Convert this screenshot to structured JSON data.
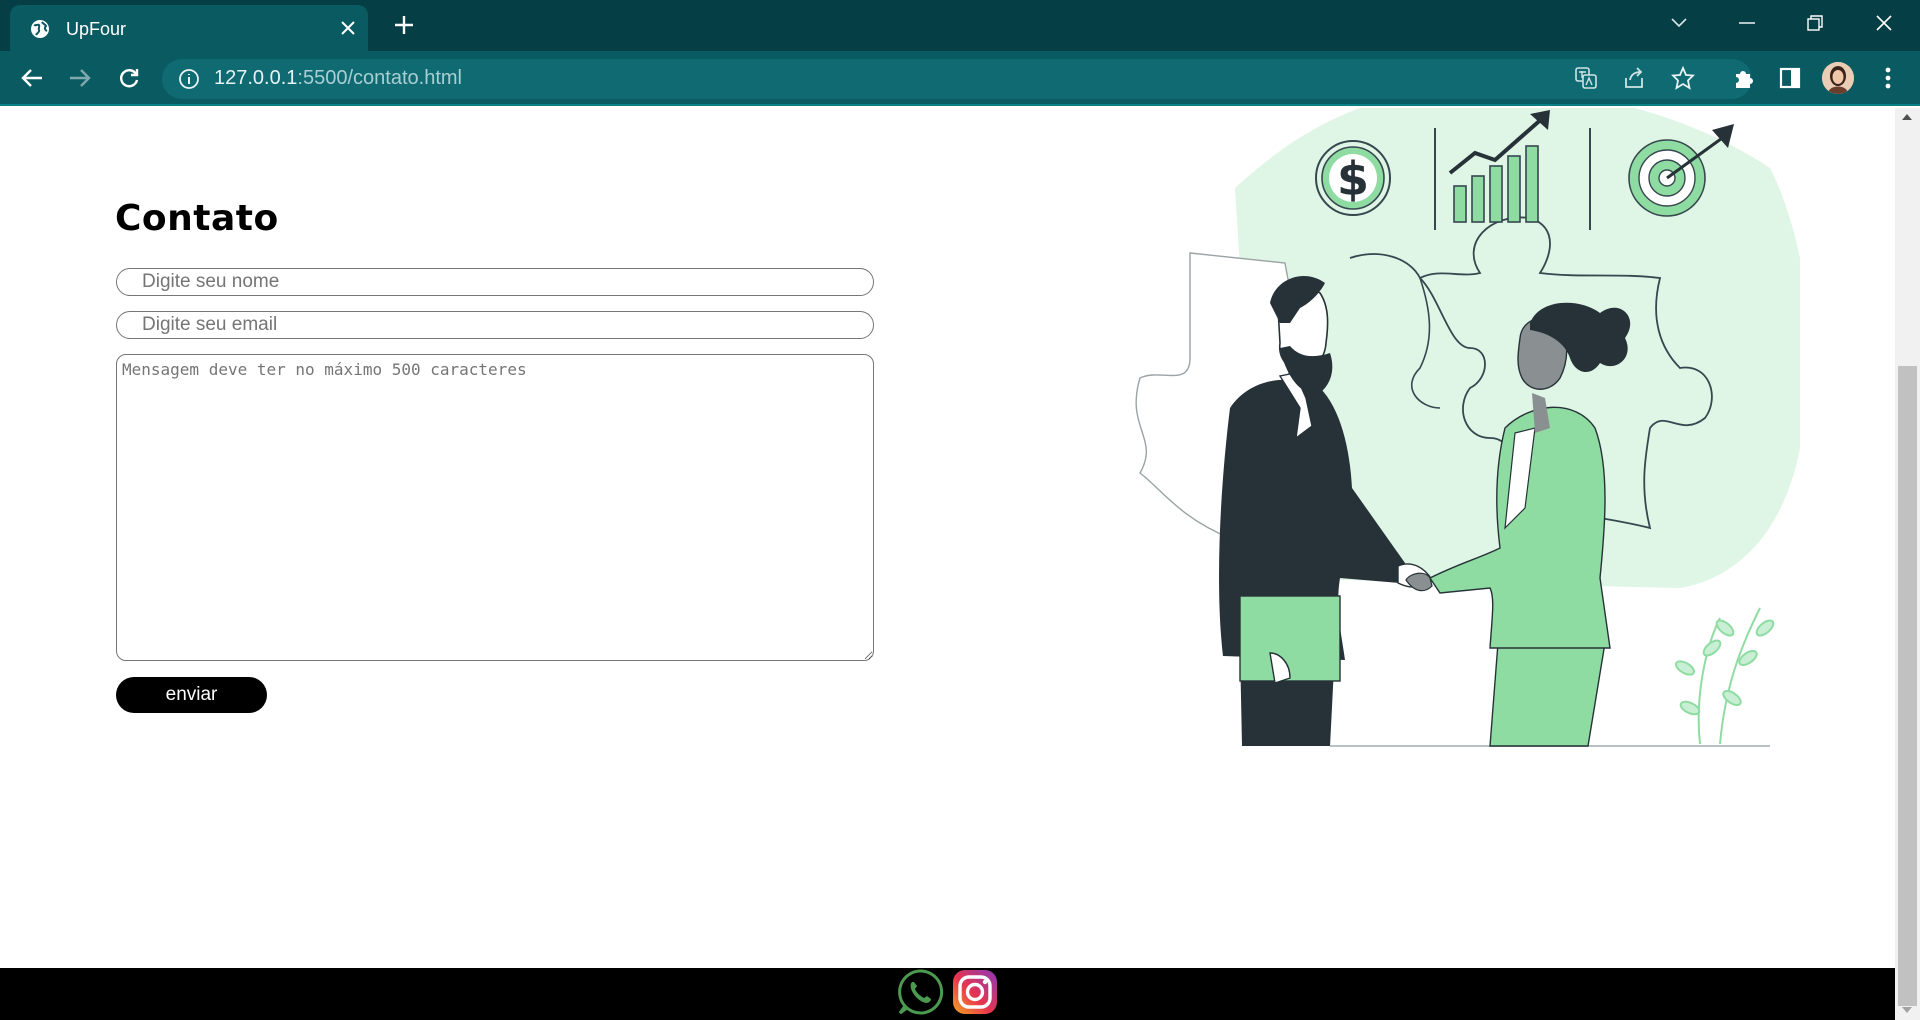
{
  "browser": {
    "tab_title": "UpFour",
    "url_host": "127.0.0.1",
    "url_path": ":5500/contato.html"
  },
  "form": {
    "heading": "Contato",
    "name_placeholder": "Digite seu nome",
    "email_placeholder": "Digite seu email",
    "message_placeholder": "Mensagem deve ter no máximo 500 caracteres",
    "send_label": "enviar"
  },
  "colors": {
    "chrome_dark": "#063e45",
    "chrome_tab": "#0a5a62",
    "accent_green": "#8fdca3",
    "light_green": "#dff5e5",
    "figure_dark": "#263238"
  },
  "footer": {
    "icons": [
      "whatsapp-icon",
      "instagram-icon"
    ]
  }
}
